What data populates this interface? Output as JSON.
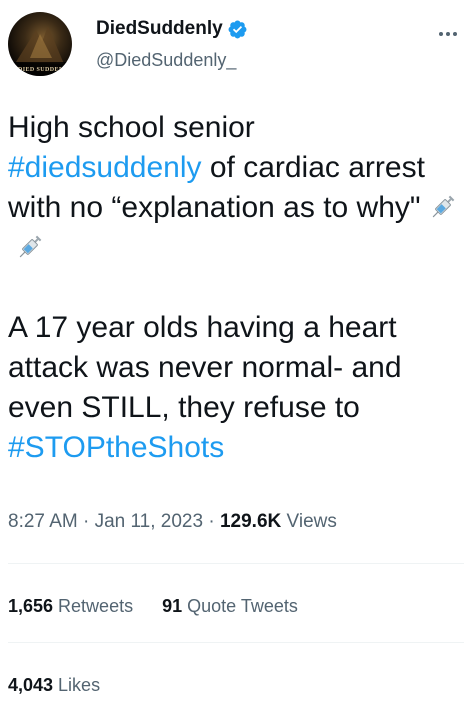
{
  "author": {
    "display_name": "DiedSuddenly",
    "handle": "@DiedSuddenly_",
    "avatar_caption": "DIED SUDDENLY",
    "verified": true,
    "icons": {
      "verified": "verified-badge-icon",
      "more": "more-options-icon"
    }
  },
  "tweet": {
    "segment_1": "High school senior\n",
    "hashtag_1": "#diedsuddenly",
    "segment_2": " of cardiac arrest with no “explanation as to why\"",
    "segment_3": "\n\nA 17 year olds having a heart attack was never normal- and even STILL, they refuse to\n",
    "hashtag_2": "#STOPtheShots",
    "emoji": "syringe-icon"
  },
  "meta": {
    "time": "8:27 AM",
    "separator": " · ",
    "date": "Jan 11, 2023",
    "views_count": "129.6K",
    "views_label": " Views"
  },
  "stats": {
    "retweets_count": "1,656",
    "retweets_label": " Retweets",
    "quote_tweets_count": "91",
    "quote_tweets_label": " Quote Tweets",
    "likes_count": "4,043",
    "likes_label": " Likes"
  },
  "colors": {
    "link": "#1d9bf0",
    "text": "#0f1419",
    "muted": "#536471",
    "divider": "#eff3f4"
  }
}
